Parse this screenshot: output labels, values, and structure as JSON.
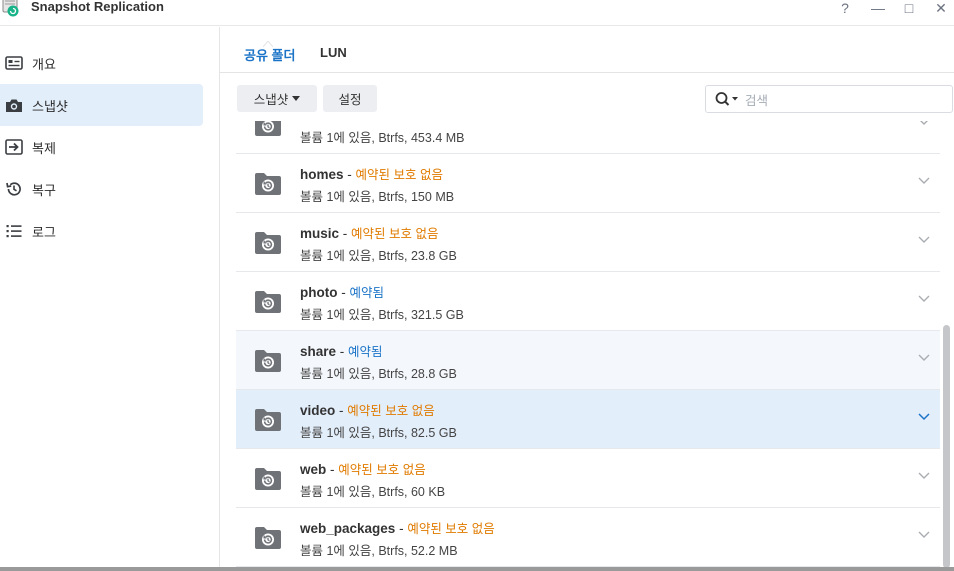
{
  "window": {
    "title": "Snapshot Replication",
    "controls": [
      "?",
      "—",
      "□",
      "✕"
    ]
  },
  "sidebar": {
    "items": [
      {
        "label": "개요",
        "icon": "overview-icon",
        "active": false
      },
      {
        "label": "스냅샷",
        "icon": "camera-icon",
        "active": true
      },
      {
        "label": "복제",
        "icon": "replication-icon",
        "active": false
      },
      {
        "label": "복구",
        "icon": "recovery-icon",
        "active": false
      },
      {
        "label": "로그",
        "icon": "log-icon",
        "active": false
      }
    ]
  },
  "tabs": [
    {
      "label": "공유 폴더",
      "active": true
    },
    {
      "label": "LUN",
      "active": false
    }
  ],
  "toolbar": {
    "snapshot_label": "스냅샷",
    "settings_label": "설정",
    "search_placeholder": "검색"
  },
  "folders": [
    {
      "name": "",
      "sep": "",
      "status": "",
      "status_type": "",
      "info": "볼륨 1에 있음, Btrfs, 453.4 MB"
    },
    {
      "name": "homes",
      "sep": " - ",
      "status": "예약된 보호 없음",
      "status_type": "warn",
      "info": "볼륨 1에 있음, Btrfs, 150 MB"
    },
    {
      "name": "music",
      "sep": " - ",
      "status": "예약된 보호 없음",
      "status_type": "warn",
      "info": "볼륨 1에 있음, Btrfs, 23.8 GB"
    },
    {
      "name": "photo",
      "sep": " - ",
      "status": "예약됨",
      "status_type": "ok",
      "info": "볼륨 1에 있음, Btrfs, 321.5 GB"
    },
    {
      "name": "share",
      "sep": " - ",
      "status": "예약됨",
      "status_type": "ok",
      "info": "볼륨 1에 있음, Btrfs, 28.8 GB"
    },
    {
      "name": "video",
      "sep": " - ",
      "status": "예약된 보호 없음",
      "status_type": "warn",
      "info": "볼륨 1에 있음, Btrfs, 82.5 GB"
    },
    {
      "name": "web",
      "sep": " - ",
      "status": "예약된 보호 없음",
      "status_type": "warn",
      "info": "볼륨 1에 있음, Btrfs, 60 KB"
    },
    {
      "name": "web_packages",
      "sep": " - ",
      "status": "예약된 보호 없음",
      "status_type": "warn",
      "info": "볼륨 1에 있음, Btrfs, 52.2 MB"
    }
  ],
  "colors": {
    "accent": "#1a73c7",
    "warning": "#e07b00",
    "selected_row": "#e3eefb",
    "icon_gray": "#6f7378"
  }
}
